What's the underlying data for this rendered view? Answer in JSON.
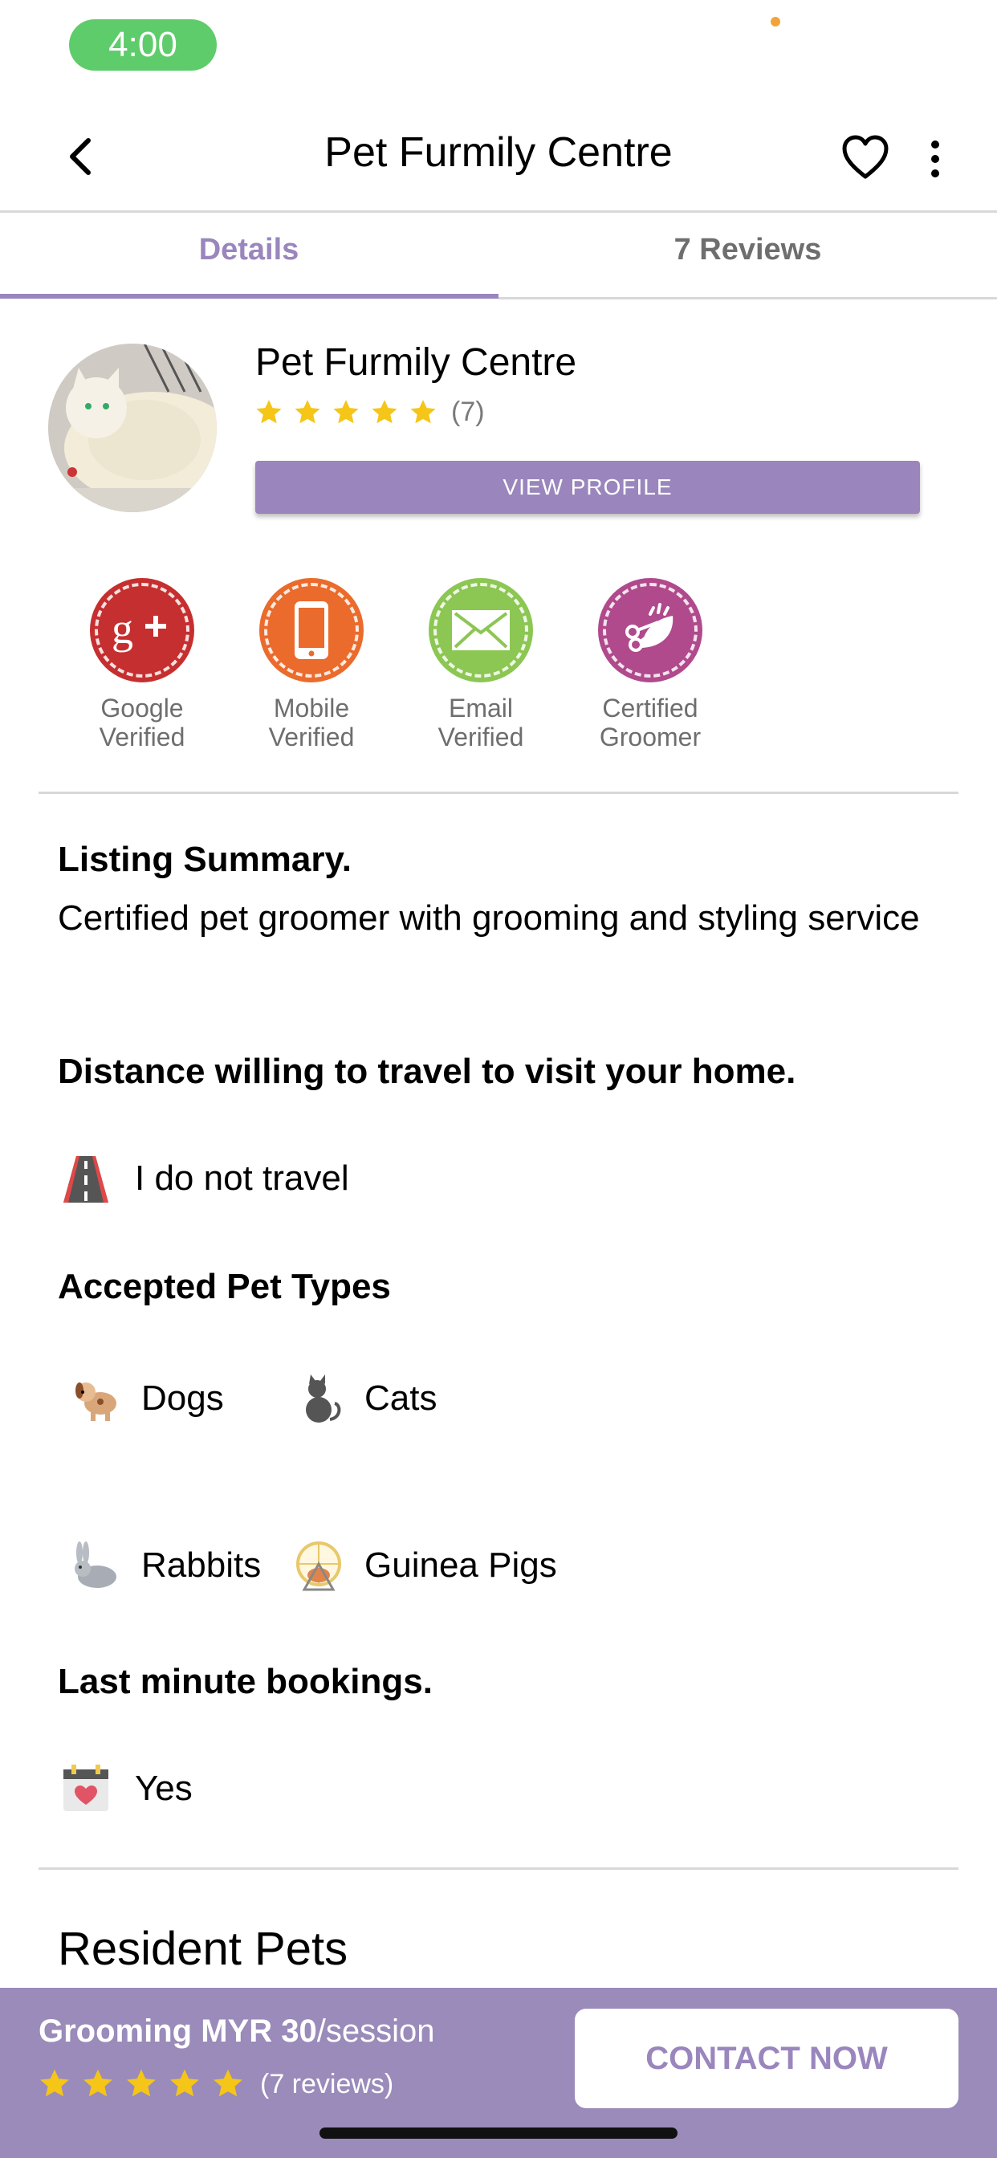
{
  "status_bar": {
    "time": "4:00"
  },
  "app_bar": {
    "title": "Pet Furmily Centre"
  },
  "tabs": [
    {
      "label": "Details",
      "active": true
    },
    {
      "label": "7 Reviews",
      "active": false
    }
  ],
  "profile": {
    "name": "Pet Furmily Centre",
    "rating": 5,
    "rating_count": "(7)",
    "view_profile_label": "VIEW PROFILE"
  },
  "badges": [
    {
      "line1": "Google",
      "line2": "Verified",
      "icon": "google-plus-icon",
      "color": "#c62f2f"
    },
    {
      "line1": "Mobile",
      "line2": "Verified",
      "icon": "mobile-phone-icon",
      "color": "#ea6b2c"
    },
    {
      "line1": "Email",
      "line2": "Verified",
      "icon": "envelope-icon",
      "color": "#8cc653"
    },
    {
      "line1": "Certified",
      "line2": "Groomer",
      "icon": "scissors-icon",
      "color": "#b04a8c"
    }
  ],
  "listing": {
    "summary_heading": "Listing Summary.",
    "summary_text": "Certified pet groomer with grooming and styling service",
    "distance_heading": "Distance willing to travel to visit your home.",
    "distance_value": "I do not travel",
    "pet_types_heading": "Accepted Pet Types",
    "pet_types": [
      "Dogs",
      "Cats",
      "Rabbits",
      "Guinea Pigs"
    ],
    "last_minute_heading": "Last minute bookings.",
    "last_minute_value": "Yes",
    "resident_pets_heading": "Resident Pets"
  },
  "bottom_bar": {
    "price_service": "Grooming MYR 30",
    "price_unit": "/session",
    "reviews_text": "(7 reviews)",
    "contact_label": "CONTACT NOW"
  },
  "colors": {
    "accent": "#9a86bd",
    "star": "#f5c518",
    "status_green": "#5fcc6b"
  }
}
